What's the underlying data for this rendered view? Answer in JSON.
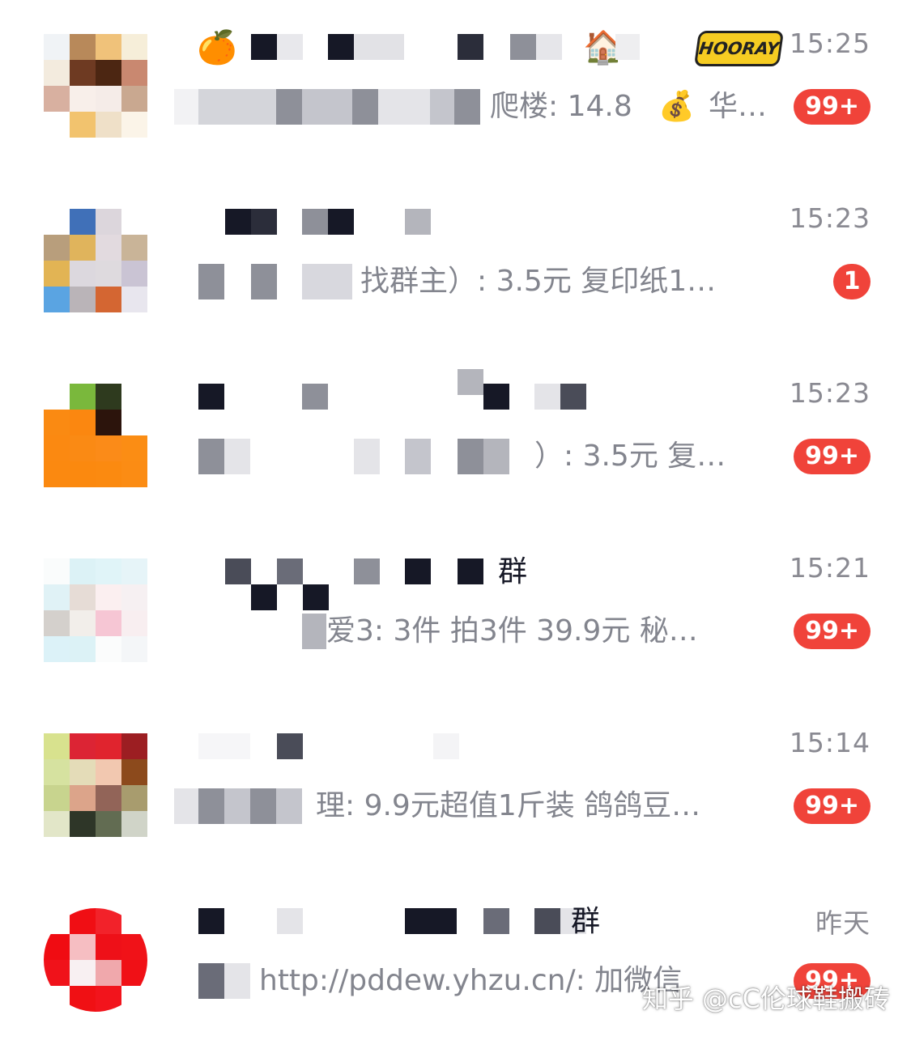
{
  "conversations": [
    {
      "time": "15:25",
      "title_emoji": "🏠",
      "title_sticker": "HOORAY",
      "avatar_emoji": "🍊",
      "preview_text": "爬楼: 14.8",
      "preview_emoji": "💰",
      "preview_tail": "华…",
      "badge": "99+"
    },
    {
      "time": "15:23",
      "preview_text": "找群主）: 3.5元 复印纸1…",
      "badge": "1"
    },
    {
      "time": "15:23",
      "preview_text": "）: 3.5元 复…",
      "badge": "99+"
    },
    {
      "time": "15:21",
      "title_tail": "群",
      "preview_text": "爱3: 3件 拍3件 39.9元 秘…",
      "badge": "99+"
    },
    {
      "time": "15:14",
      "preview_text": "理: 9.9元超值1斤装 鸽鸽豆…",
      "badge": "99+"
    },
    {
      "time": "昨天",
      "title_tail": "群",
      "preview_text": "http://pddew.yhzu.cn/: 加微信",
      "badge": "99+"
    }
  ],
  "watermark": "知乎 @cC伦球鞋搬砖",
  "colors": {
    "badge": "#f0433a",
    "time": "#8a8a92",
    "preview": "#83858e",
    "mosaic_dark": "#161826"
  }
}
